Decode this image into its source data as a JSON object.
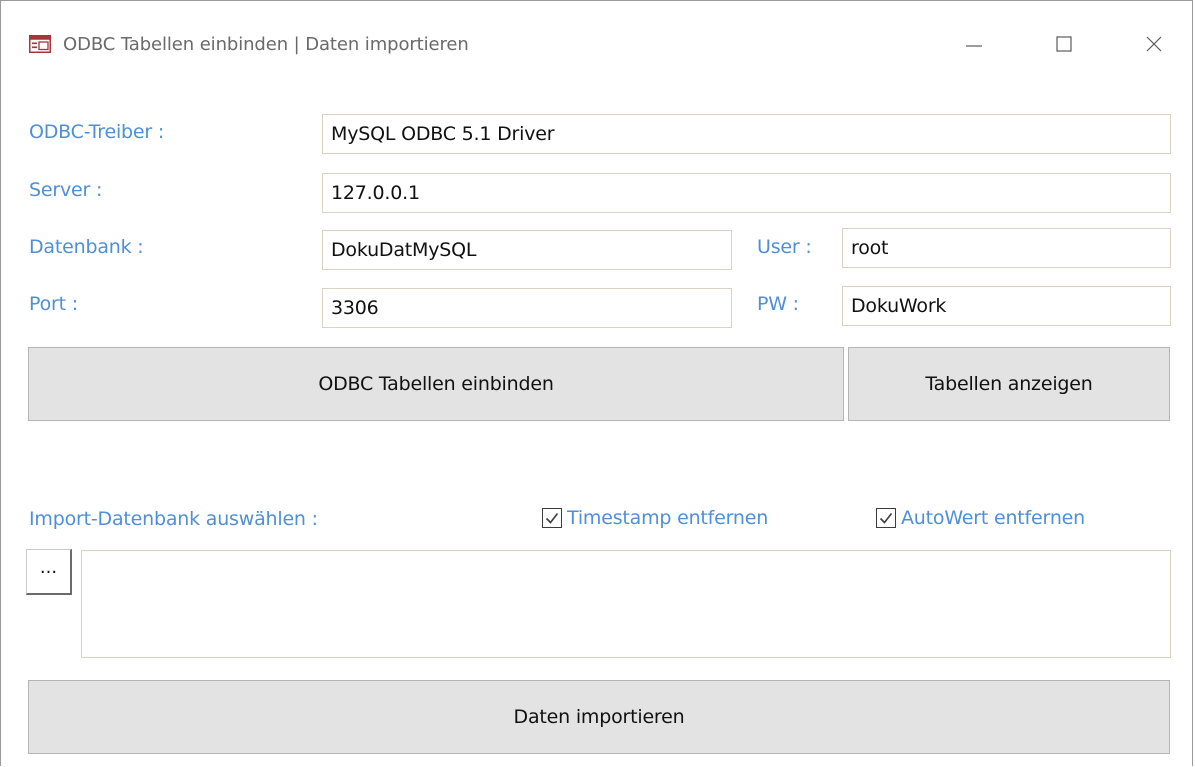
{
  "window": {
    "title": "ODBC Tabellen einbinden | Daten importieren",
    "app_icon": "form-icon",
    "controls": {
      "minimize": "minimize-icon",
      "maximize": "maximize-icon",
      "close": "close-icon"
    }
  },
  "form": {
    "driver_label": "ODBC-Treiber :",
    "driver_value": "MySQL ODBC 5.1 Driver",
    "server_label": "Server :",
    "server_value": "127.0.0.1",
    "database_label": "Datenbank :",
    "database_value": "DokuDatMySQL",
    "user_label": "User :",
    "user_value": "root",
    "port_label": "Port :",
    "port_value": "3306",
    "pw_label": "PW :",
    "pw_value": "DokuWork"
  },
  "buttons": {
    "link_tables": "ODBC Tabellen einbinden",
    "show_tables": "Tabellen anzeigen",
    "browse": "...",
    "import_data": "Daten importieren"
  },
  "import": {
    "select_label": "Import-Datenbank auswählen :",
    "timestamp_checkbox": {
      "label": "Timestamp entfernen",
      "checked": true
    },
    "autowert_checkbox": {
      "label": "AutoWert entfernen",
      "checked": true
    },
    "path_value": ""
  },
  "colors": {
    "label_blue": "#4f8fd6",
    "field_border": "#d8d3c2",
    "button_bg": "#e3e3e3"
  }
}
